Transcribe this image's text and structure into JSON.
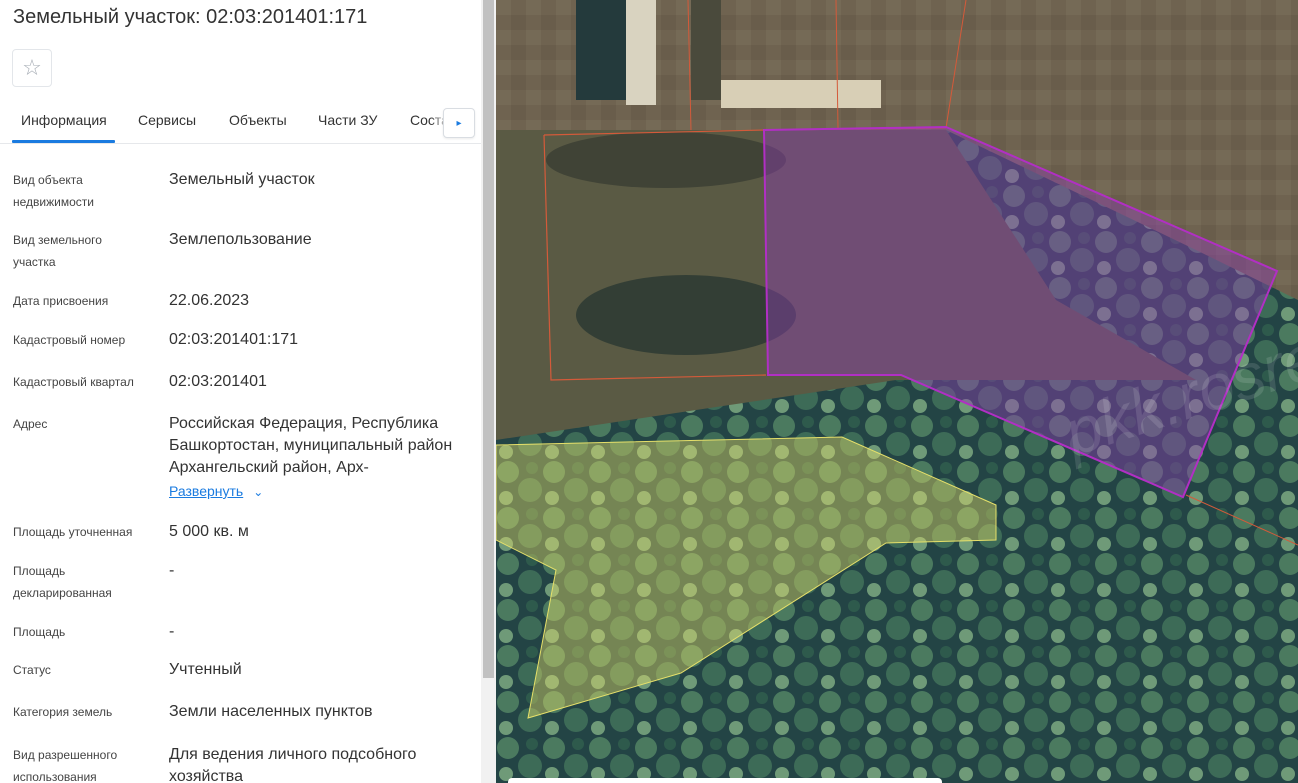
{
  "header": {
    "title": "Земельный участок: 02:03:201401:171",
    "favorite_icon": "☆"
  },
  "tabs": [
    {
      "label": "Информация",
      "active": true
    },
    {
      "label": "Сервисы"
    },
    {
      "label": "Объекты"
    },
    {
      "label": "Части ЗУ"
    },
    {
      "label": "Соста"
    }
  ],
  "tab_next_icon": "▸",
  "fields": [
    {
      "label": "Вид объекта недвижимости",
      "value": "Земельный участок"
    },
    {
      "label": "Вид земельного участка",
      "value": "Землепользование"
    },
    {
      "label": "Дата присвоения",
      "value": "22.06.2023"
    },
    {
      "label": "Кадастровый номер",
      "value": "02:03:201401:171"
    },
    {
      "label": "Кадастровый квартал",
      "value": "02:03:201401"
    },
    {
      "label": "Адрес",
      "value": "Российская Федерация, Республика Башкортостан, муниципальный район Архангельский район, Арх-",
      "expand_label": "Развернуть",
      "expand_icon": "⌄"
    },
    {
      "label": "Площадь уточненная",
      "value": "5 000 кв. м"
    },
    {
      "label": "Площадь декларированная",
      "value": "-"
    },
    {
      "label": "Площадь",
      "value": "-"
    },
    {
      "label": "Статус",
      "value": "Учтенный"
    },
    {
      "label": "Категория земель",
      "value": "Земли населенных пунктов"
    },
    {
      "label": "Вид разрешенного использования",
      "value": "Для ведения личного подсобного хозяйства"
    }
  ],
  "map": {
    "watermark": "pkk.rosreestr.ru",
    "colors": {
      "selected_parcel": "#b12fc4",
      "boundary": "#d45a3a",
      "yellow_zone": "#e6e06a"
    }
  }
}
